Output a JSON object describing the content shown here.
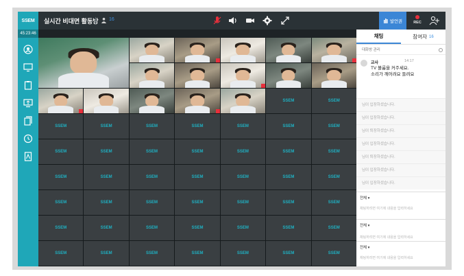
{
  "app": {
    "logo": "SSEM",
    "room_title": "실시간 비대면 활동방",
    "user_count": "16",
    "timer": "45:23:46"
  },
  "toolbar": {
    "icons": [
      "mic-icon",
      "speaker-icon",
      "camera-icon",
      "settings-icon",
      "fullscreen-icon"
    ],
    "blue_button_label": "발언권",
    "rec_label": "REC"
  },
  "rail": {
    "icons": [
      "profile-icon",
      "monitor-icon",
      "clipboard-icon",
      "screen-share-icon",
      "files-icon",
      "clock-icon",
      "document-icon"
    ]
  },
  "grid": {
    "brand_label": "SSEM",
    "video_tiles": 16,
    "empty_tiles": 45
  },
  "panel": {
    "tabs": [
      {
        "label": "채팅",
        "count": ""
      },
      {
        "label": "참여자",
        "count": "16"
      }
    ],
    "notice": "대화방 관리",
    "message": {
      "name": "교사",
      "time": "14:17",
      "line1": "TV 볼륨을 커주세요.",
      "line2": "소리가 깨어려요 들려요"
    },
    "system_messages": [
      "님이 입장하셨습니다.",
      "님이 입장하셨습니다.",
      "님이 퇴장하셨습니다.",
      "님이 입장하셨습니다.",
      "님이 퇴장하셨습니다.",
      "님이 입장하셨습니다.",
      "님이 입장하셨습니다."
    ],
    "inputs": [
      {
        "target": "전체 ▾",
        "placeholder": "채팅하려면 여기에 내용을 입력하세요"
      },
      {
        "target": "전체 ▾",
        "placeholder": "채팅하려면 여기에 내용을 입력하세요"
      },
      {
        "target": "전체 ▾",
        "placeholder": "채팅하려면 여기에 내용을 입력하세요"
      }
    ]
  },
  "colors": {
    "brand": "#1fa7b8",
    "accent_blue": "#3b86d6",
    "record_red": "#e8303c"
  }
}
